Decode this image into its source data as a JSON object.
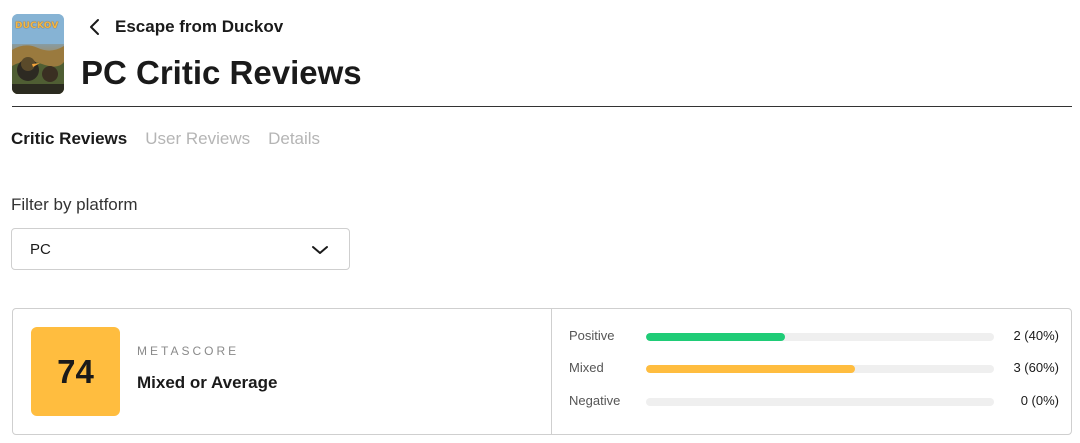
{
  "header": {
    "game_title": "Escape from Duckov",
    "page_title": "PC Critic Reviews",
    "cover_text": "DUCKOV"
  },
  "tabs": [
    {
      "label": "Critic Reviews",
      "active": true
    },
    {
      "label": "User Reviews",
      "active": false
    },
    {
      "label": "Details",
      "active": false
    }
  ],
  "filter": {
    "label": "Filter by platform",
    "selected": "PC"
  },
  "score": {
    "value": "74",
    "label": "METASCORE",
    "verdict": "Mixed or Average",
    "color": "#ffbd3f"
  },
  "distribution": [
    {
      "label": "Positive",
      "count": "2 (40%)",
      "fraction": 0.4,
      "color": "#1fcc77"
    },
    {
      "label": "Mixed",
      "count": "3 (60%)",
      "fraction": 0.6,
      "color": "#ffbd3f"
    },
    {
      "label": "Negative",
      "count": "0 (0%)",
      "fraction": 0,
      "color": "#ff6874"
    }
  ],
  "icons": {
    "back": "chevron-left-icon",
    "select": "chevron-down-icon"
  }
}
